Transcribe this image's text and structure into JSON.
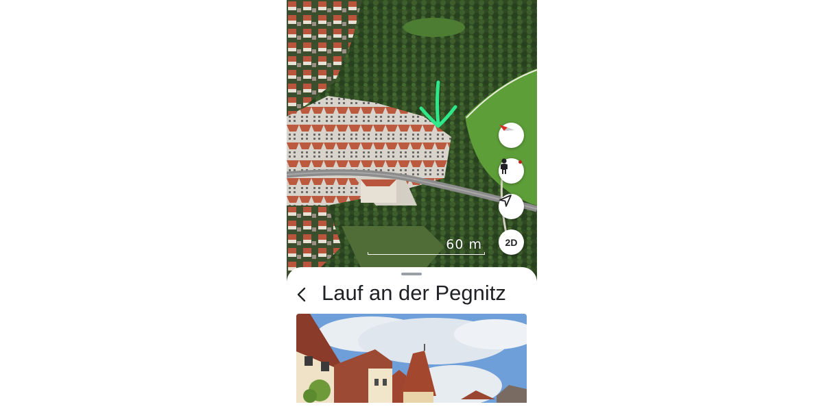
{
  "map": {
    "scale_label": "60 m",
    "controls": {
      "compass_icon": "compass-icon",
      "street_view_icon": "pegman-icon",
      "my_location_icon": "navigation-arrow-icon",
      "view_mode_label": "2D"
    },
    "annotation": {
      "icon": "hand-drawn-down-arrow-icon",
      "color": "#2ee88a"
    }
  },
  "place_sheet": {
    "back_icon": "chevron-left-icon",
    "title": "Lauf an der Pegnitz"
  },
  "colors": {
    "forest": "#2f4a23",
    "meadow": "#5e9e39",
    "roof": "#b8553c",
    "road": "#8c8c8c",
    "sky": "#6f9fd8"
  }
}
